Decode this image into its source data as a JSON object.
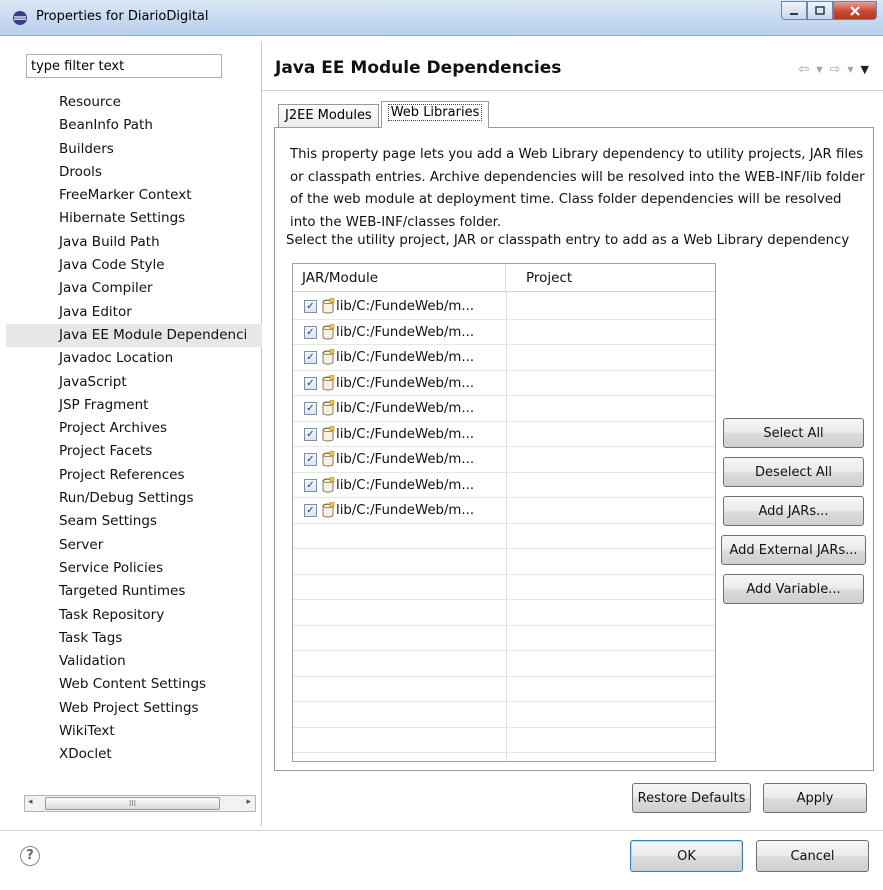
{
  "window": {
    "title": "Properties for DiarioDigital",
    "controls": [
      "minimize",
      "maximize",
      "close"
    ]
  },
  "filter": {
    "placeholder": "type filter text",
    "value": "type filter text"
  },
  "tree": {
    "items": [
      "Resource",
      "BeanInfo Path",
      "Builders",
      "Drools",
      "FreeMarker Context",
      "Hibernate Settings",
      "Java Build Path",
      "Java Code Style",
      "Java Compiler",
      "Java Editor",
      "Java EE Module Dependenci",
      "Javadoc Location",
      "JavaScript",
      "JSP Fragment",
      "Project Archives",
      "Project Facets",
      "Project References",
      "Run/Debug Settings",
      "Seam Settings",
      "Server",
      "Service Policies",
      "Targeted Runtimes",
      "Task Repository",
      "Task Tags",
      "Validation",
      "Web Content Settings",
      "Web Project Settings",
      "WikiText",
      "XDoclet"
    ],
    "selected_index": 10
  },
  "page": {
    "title": "Java EE Module Dependencies",
    "nav": {
      "back": "⇦",
      "forward": "⇨",
      "menu": "▼"
    }
  },
  "tabs": [
    {
      "label": "J2EE Modules",
      "active": false
    },
    {
      "label": "Web Libraries",
      "active": true
    }
  ],
  "description": "This property page lets you add a Web Library dependency to utility projects, JAR files or classpath entries. Archive dependencies will be resolved into the WEB-INF/lib folder of the web module at deployment time. Class folder dependencies will be resolved into the WEB-INF/classes folder.",
  "select_label": "Select the utility project, JAR or classpath entry to add as a Web Library dependency",
  "table": {
    "columns": [
      "JAR/Module",
      "Project"
    ],
    "rows": [
      {
        "jar": "lib/C:/FundeWeb/m...",
        "project": "",
        "checked": true
      },
      {
        "jar": "lib/C:/FundeWeb/m...",
        "project": "",
        "checked": true
      },
      {
        "jar": "lib/C:/FundeWeb/m...",
        "project": "",
        "checked": true
      },
      {
        "jar": "lib/C:/FundeWeb/m...",
        "project": "",
        "checked": true
      },
      {
        "jar": "lib/C:/FundeWeb/m...",
        "project": "",
        "checked": true
      },
      {
        "jar": "lib/C:/FundeWeb/m...",
        "project": "",
        "checked": true
      },
      {
        "jar": "lib/C:/FundeWeb/m...",
        "project": "",
        "checked": true
      },
      {
        "jar": "lib/C:/FundeWeb/m...",
        "project": "",
        "checked": true
      },
      {
        "jar": "lib/C:/FundeWeb/m...",
        "project": "",
        "checked": true
      }
    ],
    "empty_rows": 10
  },
  "side_buttons": {
    "select_all": "Select All",
    "deselect_all": "Deselect All",
    "add_jars": "Add JARs...",
    "add_external_jars": "Add External JARs...",
    "add_variable": "Add Variable..."
  },
  "footer": {
    "restore_defaults": "Restore Defaults",
    "apply": "Apply",
    "ok": "OK",
    "cancel": "Cancel",
    "help": "?"
  },
  "scrollbar": {
    "thumb_grip": "III",
    "left_arrow": "◂",
    "right_arrow": "▸"
  }
}
